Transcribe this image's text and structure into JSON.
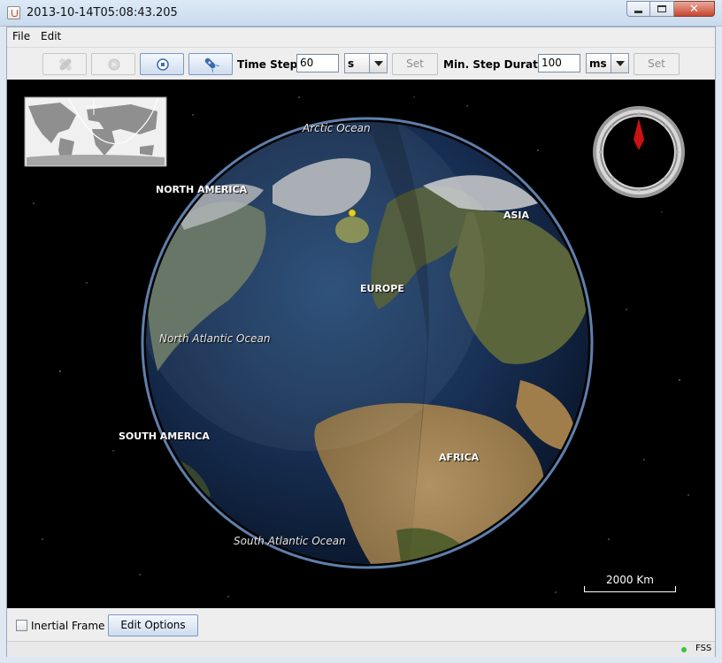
{
  "window": {
    "title": "2013-10-14T05:08:43.205"
  },
  "menu": {
    "items": [
      "File",
      "Edit"
    ]
  },
  "toolbar": {
    "time_step_label": "Time Step:",
    "time_step_value": "60",
    "time_step_unit": "s",
    "set_label": "Set",
    "min_step_label": "Min. Step Duration",
    "min_step_value": "100",
    "min_step_unit": "ms",
    "set2_label": "Set",
    "icons": [
      "satellite-icon",
      "play-icon",
      "stop-icon",
      "rocket-icon"
    ]
  },
  "viewport": {
    "labels": {
      "arctic_ocean": "Arctic Ocean",
      "north_america": "NORTH AMERICA",
      "asia": "ASIA",
      "europe": "EUROPE",
      "north_atlantic": "North Atlantic Ocean",
      "south_america": "SOUTH AMERICA",
      "africa": "AFRICA",
      "south_atlantic": "South Atlantic Ocean"
    },
    "scale": "2000 Km",
    "colors": {
      "space": "#000000",
      "ocean": "#1d3a66",
      "land": "#6b7a3a",
      "desert": "#c8a36a",
      "ice": "#eeeeee",
      "compass_needle": "#cc1111",
      "satellite": "#d6c21a"
    }
  },
  "bottom": {
    "inertial_frame_label": "Inertial Frame",
    "inertial_frame_checked": false,
    "edit_options_label": "Edit Options"
  },
  "status": {
    "text": "FSS"
  }
}
